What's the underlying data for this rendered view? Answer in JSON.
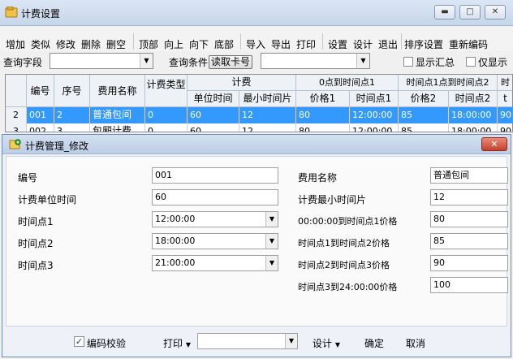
{
  "window": {
    "title": "计费设置",
    "minimize": "▬",
    "maximize": "□",
    "close": "✕"
  },
  "toolbar": [
    {
      "label": "增加"
    },
    {
      "label": "类似"
    },
    {
      "label": "修改"
    },
    {
      "label": "删除"
    },
    {
      "label": "删空"
    },
    {
      "label": "顶部"
    },
    {
      "label": "向上"
    },
    {
      "label": "向下"
    },
    {
      "label": "底部"
    },
    {
      "label": "导入"
    },
    {
      "label": "导出"
    },
    {
      "label": "打印"
    },
    {
      "label": "设置"
    },
    {
      "label": "设计"
    },
    {
      "label": "退出"
    },
    {
      "label": "排序设置"
    },
    {
      "label": "重新编码"
    }
  ],
  "query": {
    "field_label": "查询字段",
    "field_value": "",
    "condition_label": "查询条件",
    "read_card_label": "读取卡号",
    "condition_value": "",
    "show_summary_label": "显示汇总",
    "show_only_label": "仅显示",
    "show_summary_checked": false,
    "show_only_checked": false
  },
  "grid": {
    "header_top": {
      "num": "编号",
      "seq": "序号",
      "name": "费用名称",
      "type": "计费类型",
      "billing": "计费",
      "p1": "0点到时间点1",
      "p2": "时间点1点到时间点2",
      "p3": "时"
    },
    "header_sub": {
      "unit": "单位时间",
      "min": "最小时间片",
      "price1": "价格1",
      "time1": "时间点1",
      "price2": "价格2",
      "time2": "时间点2",
      "more": "t"
    },
    "rows": [
      {
        "idx": "2",
        "num": "001",
        "seq": "2",
        "name": "普通包间",
        "type": "0",
        "unit": "60",
        "min": "12",
        "price1": "80",
        "time1": "12:00:00",
        "price2": "85",
        "time2": "18:00:00",
        "more": "90",
        "selected": true
      },
      {
        "idx": "3",
        "num": "002",
        "seq": "3",
        "name": "包厢计费",
        "type": "0",
        "unit": "60",
        "min": "12",
        "price1": "80",
        "time1": "12:00:00",
        "price2": "85",
        "time2": "18:00:00",
        "more": "90",
        "selected": false
      }
    ]
  },
  "dialog": {
    "title": "计费管理_修改",
    "close": "✕",
    "fields": {
      "num_label": "编号",
      "num_value": "001",
      "unit_label": "计费单位时间",
      "unit_value": "60",
      "t1_label": "时间点1",
      "t1_value": "12:00:00",
      "t2_label": "时间点2",
      "t2_value": "18:00:00",
      "t3_label": "时间点3",
      "t3_value": "21:00:00",
      "name_label": "费用名称",
      "name_value": "普通包间",
      "min_label": "计费最小时间片",
      "min_value": "12",
      "p1_label": "00:00:00到时间点1价格",
      "p1_value": "80",
      "p2_label": "时间点1到时间点2价格",
      "p2_value": "85",
      "p3_label": "时间点2到时间点3价格",
      "p3_value": "90",
      "p4_label": "时间点3到24:00:00价格",
      "p4_value": "100"
    },
    "footer": {
      "verify_label": "编码校验",
      "verify_checked": true,
      "print_label": "打印",
      "print_value": "",
      "design_label": "设计",
      "ok_label": "确定",
      "cancel_label": "取消"
    }
  },
  "colors": {
    "selection": "#3399ff",
    "title_bar": "#c7d6ea",
    "close_button": "#c4412c"
  }
}
